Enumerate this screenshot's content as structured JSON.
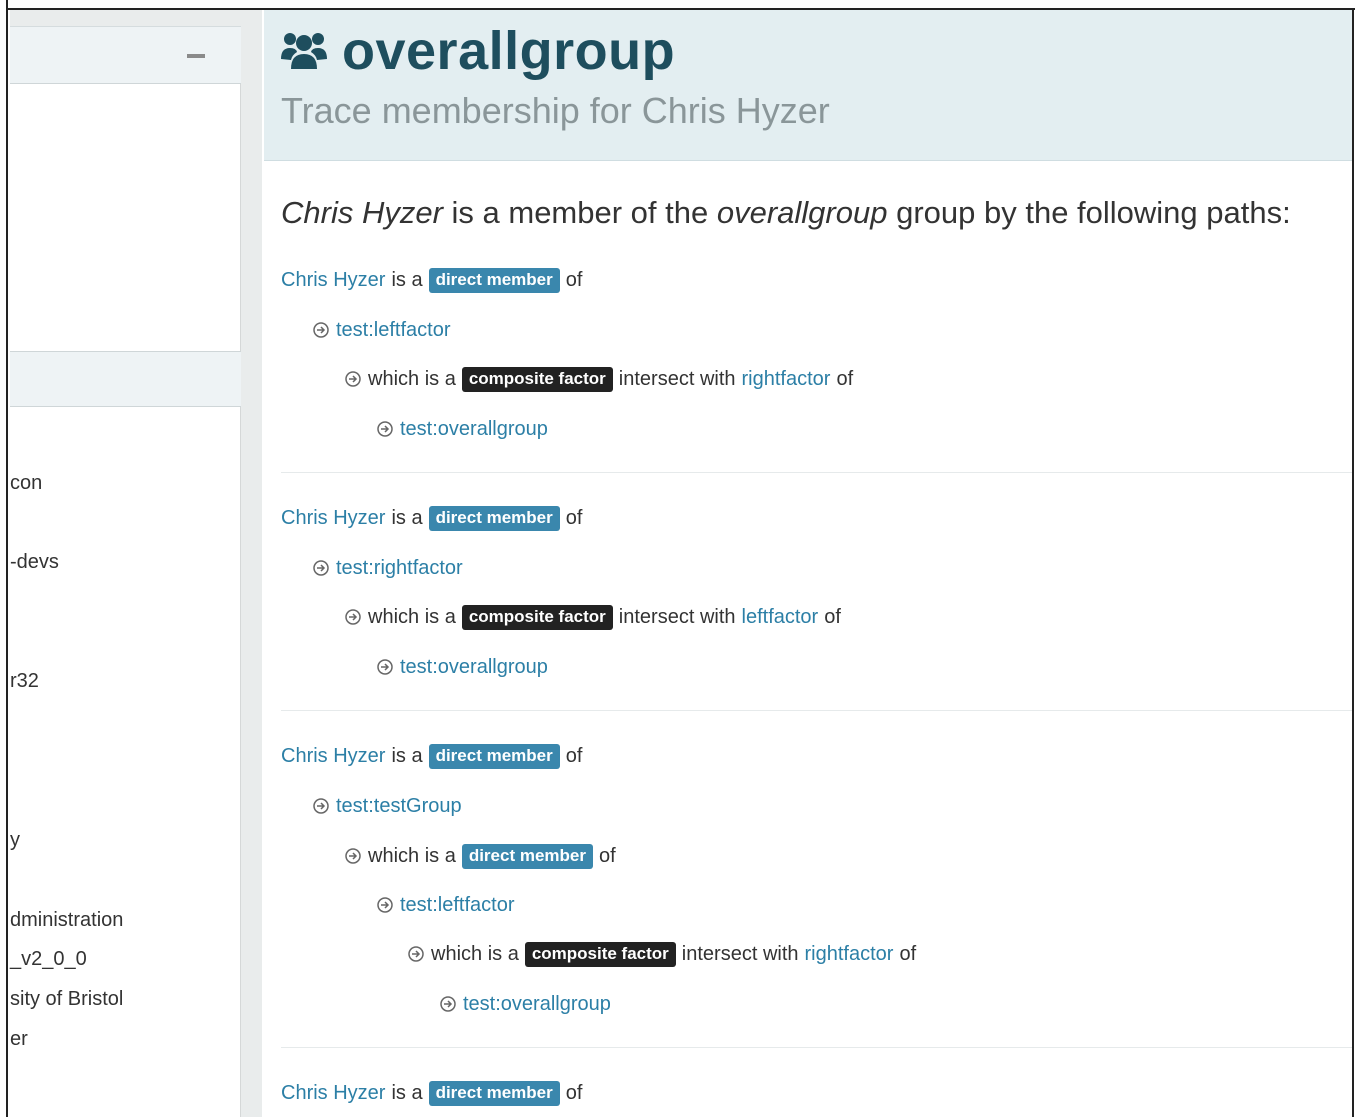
{
  "sidebar": {
    "items": [
      "con",
      "-devs",
      "r32",
      "y",
      "dministration",
      "_v2_0_0",
      "sity of Bristol",
      "er"
    ]
  },
  "header": {
    "title": "overallgroup",
    "subtitle": "Trace membership for Chris Hyzer",
    "icon": "users-icon"
  },
  "intro": {
    "subject": "Chris Hyzer",
    "mid": " is a member of the ",
    "group": "overallgroup",
    "end": " group by the following paths:"
  },
  "labels": {
    "is_a": "is a",
    "of": "of",
    "which_is_a": "which is a",
    "intersect_with": "intersect with",
    "direct_member": "direct member",
    "composite_factor": "composite factor"
  },
  "paths": [
    {
      "subject": "Chris Hyzer",
      "steps": [
        {
          "type": "group",
          "name": "test:leftfactor"
        },
        {
          "type": "composite",
          "factor": "rightfactor"
        },
        {
          "type": "group",
          "name": "test:overallgroup"
        }
      ]
    },
    {
      "subject": "Chris Hyzer",
      "steps": [
        {
          "type": "group",
          "name": "test:rightfactor"
        },
        {
          "type": "composite",
          "factor": "leftfactor"
        },
        {
          "type": "group",
          "name": "test:overallgroup"
        }
      ]
    },
    {
      "subject": "Chris Hyzer",
      "steps": [
        {
          "type": "group",
          "name": "test:testGroup"
        },
        {
          "type": "direct"
        },
        {
          "type": "group",
          "name": "test:leftfactor"
        },
        {
          "type": "composite",
          "factor": "rightfactor"
        },
        {
          "type": "group",
          "name": "test:overallgroup"
        }
      ]
    },
    {
      "subject": "Chris Hyzer",
      "steps": []
    }
  ],
  "colors": {
    "link": "#2c7fa6",
    "badge_direct": "#3a87ad",
    "badge_composite": "#222222",
    "title": "#1e4e5e",
    "header_bg": "#e3eef1"
  }
}
